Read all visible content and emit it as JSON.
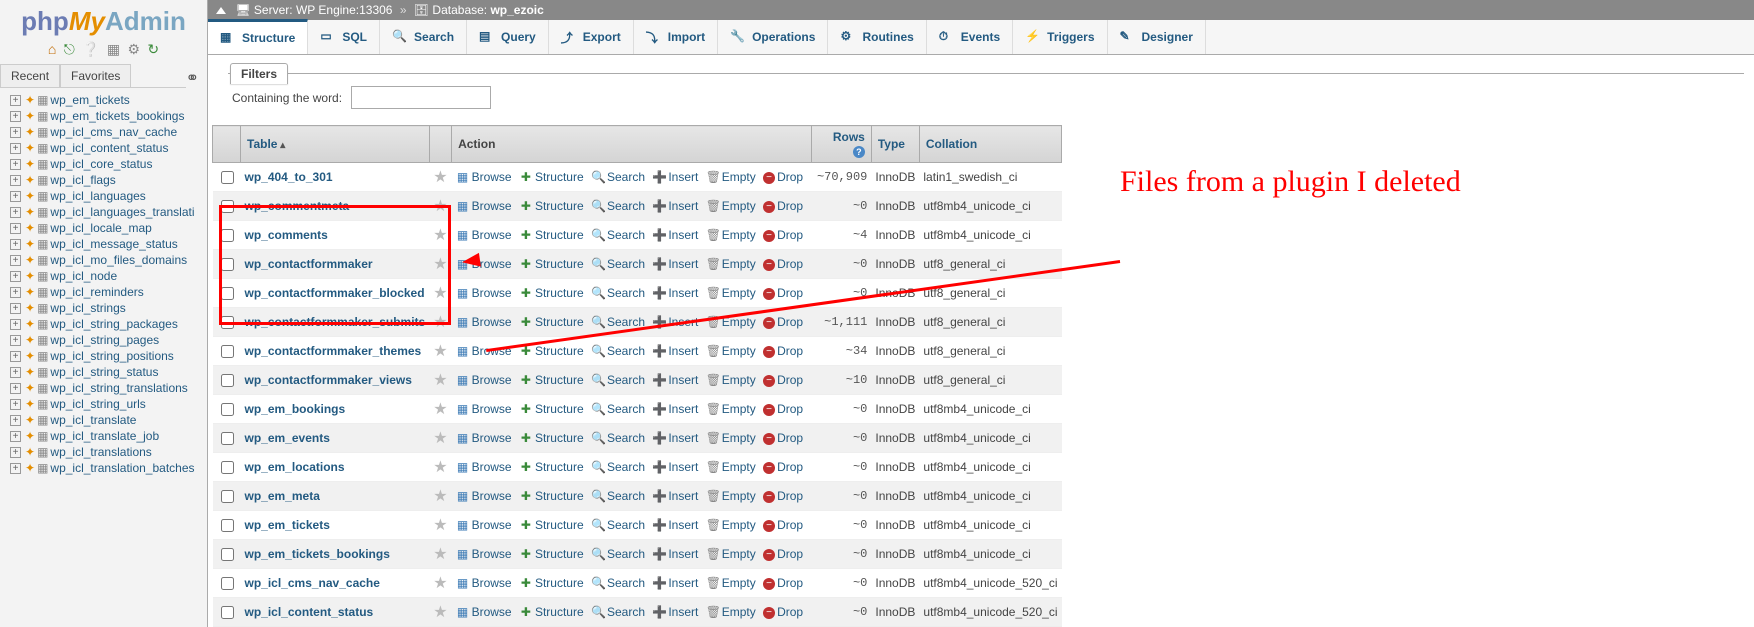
{
  "logo": {
    "a": "php",
    "b": "My",
    "c": "Admin"
  },
  "sidebar_tabs": {
    "recent": "Recent",
    "fav": "Favorites"
  },
  "tree": [
    "wp_em_tickets",
    "wp_em_tickets_bookings",
    "wp_icl_cms_nav_cache",
    "wp_icl_content_status",
    "wp_icl_core_status",
    "wp_icl_flags",
    "wp_icl_languages",
    "wp_icl_languages_translati",
    "wp_icl_locale_map",
    "wp_icl_message_status",
    "wp_icl_mo_files_domains",
    "wp_icl_node",
    "wp_icl_reminders",
    "wp_icl_strings",
    "wp_icl_string_packages",
    "wp_icl_string_pages",
    "wp_icl_string_positions",
    "wp_icl_string_status",
    "wp_icl_string_translations",
    "wp_icl_string_urls",
    "wp_icl_translate",
    "wp_icl_translate_job",
    "wp_icl_translations",
    "wp_icl_translation_batches"
  ],
  "breadcrumb": {
    "server_label": "Server:",
    "server": "WP Engine:13306",
    "db_label": "Database:",
    "db": "wp_ezoic"
  },
  "tabs": [
    {
      "id": "structure",
      "label": "Structure"
    },
    {
      "id": "sql",
      "label": "SQL"
    },
    {
      "id": "search",
      "label": "Search"
    },
    {
      "id": "query",
      "label": "Query"
    },
    {
      "id": "export",
      "label": "Export"
    },
    {
      "id": "import",
      "label": "Import"
    },
    {
      "id": "operations",
      "label": "Operations"
    },
    {
      "id": "routines",
      "label": "Routines"
    },
    {
      "id": "events",
      "label": "Events"
    },
    {
      "id": "triggers",
      "label": "Triggers"
    },
    {
      "id": "designer",
      "label": "Designer"
    }
  ],
  "filters": {
    "tab": "Filters",
    "label": "Containing the word:"
  },
  "columns": {
    "table": "Table",
    "action": "Action",
    "rows": "Rows",
    "type": "Type",
    "collation": "Collation"
  },
  "actions": {
    "browse": "Browse",
    "structure": "Structure",
    "search": "Search",
    "insert": "Insert",
    "empty": "Empty",
    "drop": "Drop"
  },
  "tables": [
    {
      "name": "wp_404_to_301",
      "rows": "~70,909",
      "type": "InnoDB",
      "coll": "latin1_swedish_ci"
    },
    {
      "name": "wp_commentmeta",
      "rows": "~0",
      "type": "InnoDB",
      "coll": "utf8mb4_unicode_ci"
    },
    {
      "name": "wp_comments",
      "rows": "~4",
      "type": "InnoDB",
      "coll": "utf8mb4_unicode_ci"
    },
    {
      "name": "wp_contactformmaker",
      "rows": "~0",
      "type": "InnoDB",
      "coll": "utf8_general_ci"
    },
    {
      "name": "wp_contactformmaker_blocked",
      "rows": "~0",
      "type": "InnoDB",
      "coll": "utf8_general_ci"
    },
    {
      "name": "wp_contactformmaker_submits",
      "rows": "~1,111",
      "type": "InnoDB",
      "coll": "utf8_general_ci"
    },
    {
      "name": "wp_contactformmaker_themes",
      "rows": "~34",
      "type": "InnoDB",
      "coll": "utf8_general_ci"
    },
    {
      "name": "wp_contactformmaker_views",
      "rows": "~10",
      "type": "InnoDB",
      "coll": "utf8_general_ci"
    },
    {
      "name": "wp_em_bookings",
      "rows": "~0",
      "type": "InnoDB",
      "coll": "utf8mb4_unicode_ci"
    },
    {
      "name": "wp_em_events",
      "rows": "~0",
      "type": "InnoDB",
      "coll": "utf8mb4_unicode_ci"
    },
    {
      "name": "wp_em_locations",
      "rows": "~0",
      "type": "InnoDB",
      "coll": "utf8mb4_unicode_ci"
    },
    {
      "name": "wp_em_meta",
      "rows": "~0",
      "type": "InnoDB",
      "coll": "utf8mb4_unicode_ci"
    },
    {
      "name": "wp_em_tickets",
      "rows": "~0",
      "type": "InnoDB",
      "coll": "utf8mb4_unicode_ci"
    },
    {
      "name": "wp_em_tickets_bookings",
      "rows": "~0",
      "type": "InnoDB",
      "coll": "utf8mb4_unicode_ci"
    },
    {
      "name": "wp_icl_cms_nav_cache",
      "rows": "~0",
      "type": "InnoDB",
      "coll": "utf8mb4_unicode_520_ci"
    },
    {
      "name": "wp_icl_content_status",
      "rows": "~0",
      "type": "InnoDB",
      "coll": "utf8mb4_unicode_520_ci"
    }
  ],
  "annotation": {
    "text": "Files from a plugin I deleted"
  }
}
